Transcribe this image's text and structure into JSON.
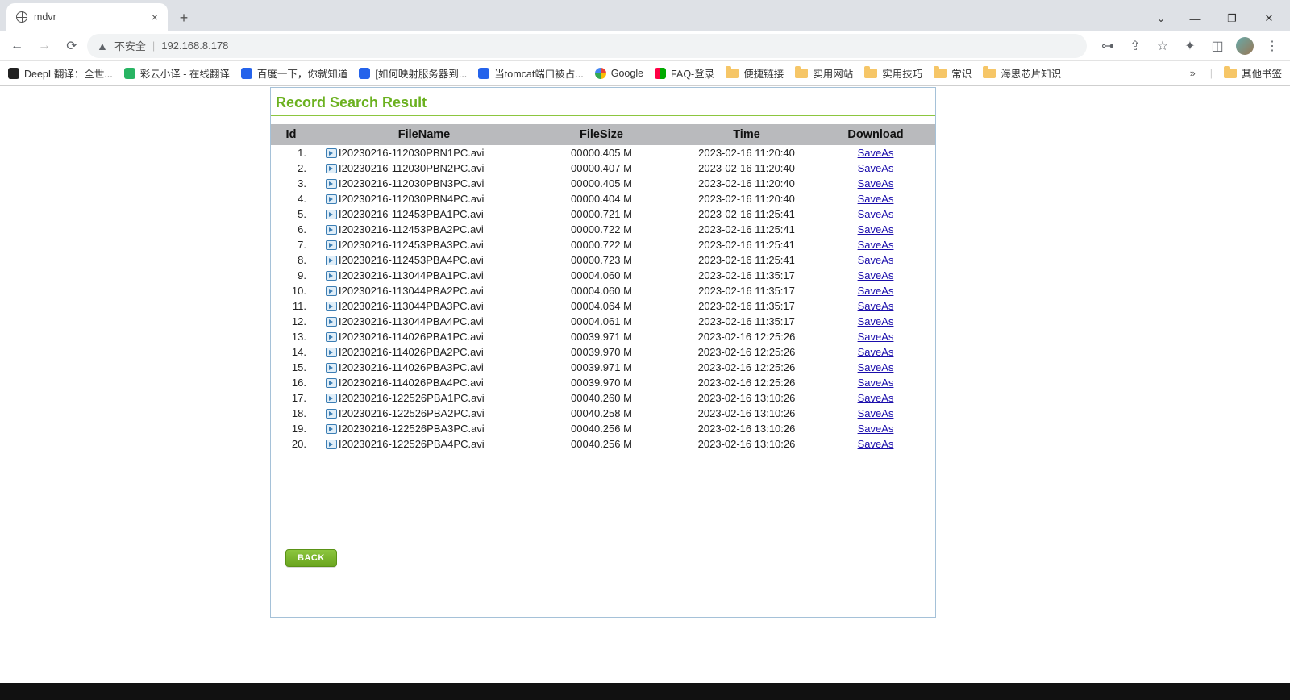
{
  "browser": {
    "tab_title": "mdvr",
    "url_security": "不安全",
    "url": "192.168.8.178",
    "bookmarks": [
      {
        "label": "DeepL翻译：全世...",
        "iconClass": "black"
      },
      {
        "label": "彩云小译 - 在线翻译",
        "iconClass": "green"
      },
      {
        "label": "百度一下，你就知道",
        "iconClass": "paw"
      },
      {
        "label": "[如何映射服务器到...",
        "iconClass": "bluetxt"
      },
      {
        "label": "当tomcat端口被占...",
        "iconClass": "paw"
      },
      {
        "label": "Google",
        "iconClass": "google"
      },
      {
        "label": "FAQ-登录",
        "iconClass": "faq"
      },
      {
        "label": "便捷链接",
        "iconClass": "folder"
      },
      {
        "label": "实用网站",
        "iconClass": "folder"
      },
      {
        "label": "实用技巧",
        "iconClass": "folder"
      },
      {
        "label": "常识",
        "iconClass": "folder"
      },
      {
        "label": "海思芯片知识",
        "iconClass": "folder"
      }
    ],
    "bm_overflow": "其他书签"
  },
  "page": {
    "title": "Record Search Result",
    "columns": {
      "id": "Id",
      "filename": "FileName",
      "filesize": "FileSize",
      "time": "Time",
      "download": "Download"
    },
    "download_label": "SaveAs",
    "back_label": "BACK",
    "rows": [
      {
        "id": "1.",
        "name": "I20230216-112030PBN1PC.avi",
        "size": "00000.405 M",
        "time": "2023-02-16 11:20:40"
      },
      {
        "id": "2.",
        "name": "I20230216-112030PBN2PC.avi",
        "size": "00000.407 M",
        "time": "2023-02-16 11:20:40"
      },
      {
        "id": "3.",
        "name": "I20230216-112030PBN3PC.avi",
        "size": "00000.405 M",
        "time": "2023-02-16 11:20:40"
      },
      {
        "id": "4.",
        "name": "I20230216-112030PBN4PC.avi",
        "size": "00000.404 M",
        "time": "2023-02-16 11:20:40"
      },
      {
        "id": "5.",
        "name": "I20230216-112453PBA1PC.avi",
        "size": "00000.721 M",
        "time": "2023-02-16 11:25:41"
      },
      {
        "id": "6.",
        "name": "I20230216-112453PBA2PC.avi",
        "size": "00000.722 M",
        "time": "2023-02-16 11:25:41"
      },
      {
        "id": "7.",
        "name": "I20230216-112453PBA3PC.avi",
        "size": "00000.722 M",
        "time": "2023-02-16 11:25:41"
      },
      {
        "id": "8.",
        "name": "I20230216-112453PBA4PC.avi",
        "size": "00000.723 M",
        "time": "2023-02-16 11:25:41"
      },
      {
        "id": "9.",
        "name": "I20230216-113044PBA1PC.avi",
        "size": "00004.060 M",
        "time": "2023-02-16 11:35:17"
      },
      {
        "id": "10.",
        "name": "I20230216-113044PBA2PC.avi",
        "size": "00004.060 M",
        "time": "2023-02-16 11:35:17"
      },
      {
        "id": "11.",
        "name": "I20230216-113044PBA3PC.avi",
        "size": "00004.064 M",
        "time": "2023-02-16 11:35:17"
      },
      {
        "id": "12.",
        "name": "I20230216-113044PBA4PC.avi",
        "size": "00004.061 M",
        "time": "2023-02-16 11:35:17"
      },
      {
        "id": "13.",
        "name": "I20230216-114026PBA1PC.avi",
        "size": "00039.971 M",
        "time": "2023-02-16 12:25:26"
      },
      {
        "id": "14.",
        "name": "I20230216-114026PBA2PC.avi",
        "size": "00039.970 M",
        "time": "2023-02-16 12:25:26"
      },
      {
        "id": "15.",
        "name": "I20230216-114026PBA3PC.avi",
        "size": "00039.971 M",
        "time": "2023-02-16 12:25:26"
      },
      {
        "id": "16.",
        "name": "I20230216-114026PBA4PC.avi",
        "size": "00039.970 M",
        "time": "2023-02-16 12:25:26"
      },
      {
        "id": "17.",
        "name": "I20230216-122526PBA1PC.avi",
        "size": "00040.260 M",
        "time": "2023-02-16 13:10:26"
      },
      {
        "id": "18.",
        "name": "I20230216-122526PBA2PC.avi",
        "size": "00040.258 M",
        "time": "2023-02-16 13:10:26"
      },
      {
        "id": "19.",
        "name": "I20230216-122526PBA3PC.avi",
        "size": "00040.256 M",
        "time": "2023-02-16 13:10:26"
      },
      {
        "id": "20.",
        "name": "I20230216-122526PBA4PC.avi",
        "size": "00040.256 M",
        "time": "2023-02-16 13:10:26"
      }
    ]
  }
}
